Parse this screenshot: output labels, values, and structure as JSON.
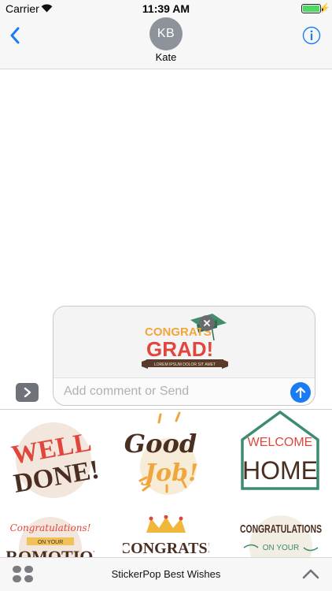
{
  "status_bar": {
    "carrier": "Carrier",
    "time": "11:39 AM",
    "battery_level_percent": 100,
    "battery_color": "#4cd964"
  },
  "header": {
    "back_icon": "chevron-left-icon",
    "avatar_initials": "KB",
    "contact_name": "Kate",
    "info_icon": "info-icon",
    "accent_color": "#1a7cf5"
  },
  "compose": {
    "placeholder": "Add comment or Send",
    "sticker": {
      "line1": "CONGRATS",
      "line2": "GRAD!",
      "ribbon": "LOREM IPSUM DOLOR SIT AMET"
    },
    "remove_icon": "close-icon",
    "send_icon": "arrow-up-icon",
    "expand_icon": "chevron-right-icon"
  },
  "drawer": {
    "stickers": [
      {
        "line1": "WELL",
        "line2": "DONE!"
      },
      {
        "line1": "Good",
        "line2": "Job!"
      },
      {
        "line1": "WELCOME",
        "line2": "HOME"
      },
      {
        "line1": "Congratulations!",
        "line2": "ON YOUR",
        "line3": "PROMOTION"
      },
      {
        "line1": "CONGRATS!"
      },
      {
        "line1": "CONGRATULATIONS",
        "line2": "ON YOUR"
      }
    ],
    "title": "StickerPop Best Wishes",
    "apps_icon": "app-grid-icon",
    "collapse_icon": "chevron-up-icon"
  }
}
